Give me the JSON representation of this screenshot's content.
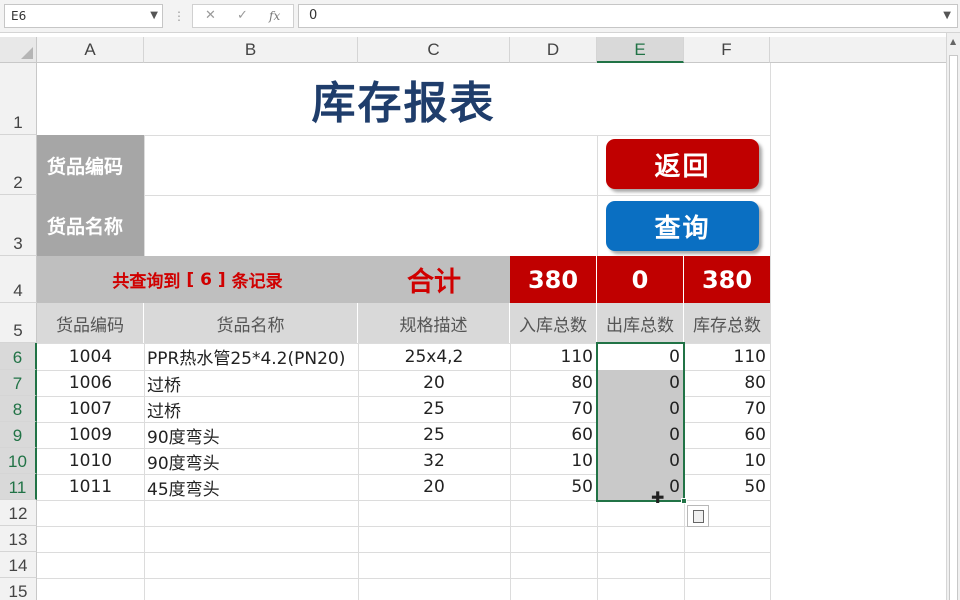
{
  "formula_bar": {
    "name_box": "E6",
    "cancel_icon": "✕",
    "enter_icon": "✓",
    "fx_label": "fx",
    "value": "0"
  },
  "columns": [
    "A",
    "B",
    "C",
    "D",
    "E",
    "F"
  ],
  "rows": [
    "1",
    "2",
    "3",
    "4",
    "5",
    "6",
    "7",
    "8",
    "9",
    "10",
    "11",
    "12",
    "13",
    "14",
    "15"
  ],
  "selected_cell": "E6",
  "report": {
    "title": "库存报表",
    "code_label": "货品编码",
    "name_label": "货品名称",
    "back_button": "返回",
    "query_button": "查询",
    "summary_prefix": "共查询到",
    "summary_count_text": "[ 6 ]",
    "summary_suffix": "条记录",
    "total_label": "合计",
    "totals": {
      "in": "380",
      "out": "0",
      "stock": "380"
    },
    "headers": [
      "货品编码",
      "货品名称",
      "规格描述",
      "入库总数",
      "出库总数",
      "库存总数"
    ],
    "data": [
      [
        "1004",
        "PPR热水管25*4.2(PN20)",
        "25x4,2",
        "110",
        "0",
        "110"
      ],
      [
        "1006",
        "过桥",
        "20",
        "80",
        "0",
        "80"
      ],
      [
        "1007",
        "过桥",
        "25",
        "70",
        "0",
        "70"
      ],
      [
        "1009",
        "90度弯头",
        "25",
        "60",
        "0",
        "60"
      ],
      [
        "1010",
        "90度弯头",
        "32",
        "10",
        "0",
        "10"
      ],
      [
        "1011",
        "45度弯头",
        "20",
        "50",
        "0",
        "50"
      ]
    ]
  },
  "colors": {
    "accent_green": "#217346",
    "button_red": "#c00000",
    "button_blue": "#0a6fc2",
    "title_blue": "#1f3d6b"
  }
}
